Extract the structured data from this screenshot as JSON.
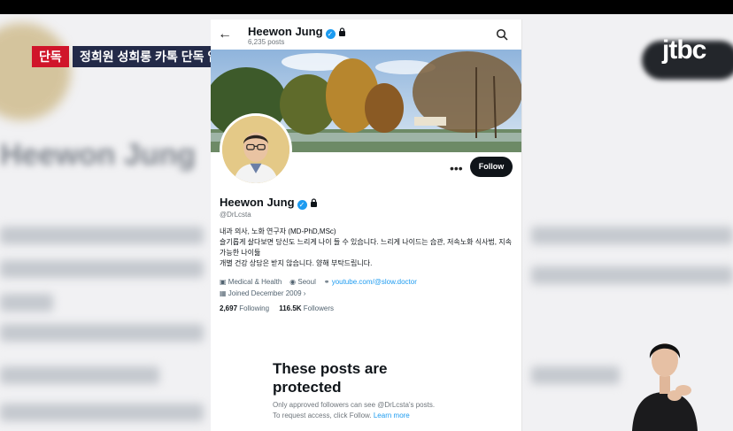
{
  "broadcast": {
    "tag": "단독",
    "headline": "정희원 성희롱 카톡 단독 입수",
    "logo": "jtbc"
  },
  "header": {
    "name": "Heewon Jung",
    "posts": "6,235 posts"
  },
  "profile": {
    "name": "Heewon Jung",
    "handle": "@DrLcsta",
    "follow_label": "Follow",
    "bio_lines": [
      "내과 의사, 노화 연구자 (MD-PhD,MSc)",
      "슬기롭게 살다보면 당신도 느리게 나이 들 수 있습니다. 느리게 나이드는 습관, 저속노화 식사법, 지속가능한 나이듦",
      "개별 건강 상담은 받지 않습니다. 양해 부탁드립니다."
    ],
    "category": "Medical & Health",
    "location": "Seoul",
    "link": "youtube.com/@slow.doctor",
    "joined": "Joined December 2009",
    "following_count": "2,697",
    "following_label": "Following",
    "followers_count": "116.5K",
    "followers_label": "Followers"
  },
  "protected": {
    "title": "These posts are protected",
    "line1": "Only approved followers can see @DrLcsta's posts.",
    "line2": "To request access, click Follow.",
    "learn_more": "Learn more"
  },
  "colors": {
    "accent": "#1d9bf0",
    "tag_red": "#d0152a",
    "headline_navy": "#232a48"
  }
}
